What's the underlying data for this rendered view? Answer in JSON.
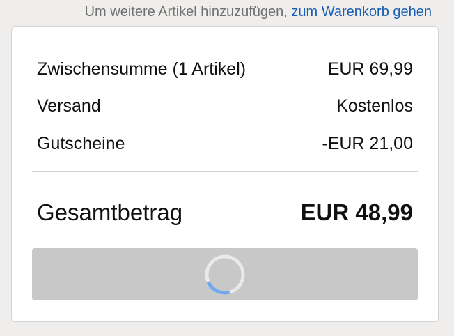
{
  "top_note": {
    "text": "Um weitere Artikel hinzuzufügen, ",
    "link": "zum Warenkorb gehen"
  },
  "summary": {
    "subtotal_label": "Zwischensumme (1 Artikel)",
    "subtotal_value": "EUR 69,99",
    "shipping_label": "Versand",
    "shipping_value": "Kostenlos",
    "coupons_label": "Gutscheine",
    "coupons_value": "-EUR 21,00",
    "total_label": "Gesamtbetrag",
    "total_value": "EUR 48,99"
  },
  "checkout": {
    "state": "loading",
    "spinner_icon": "loading-spinner-icon",
    "spinner_color": "#6fa8ec"
  }
}
